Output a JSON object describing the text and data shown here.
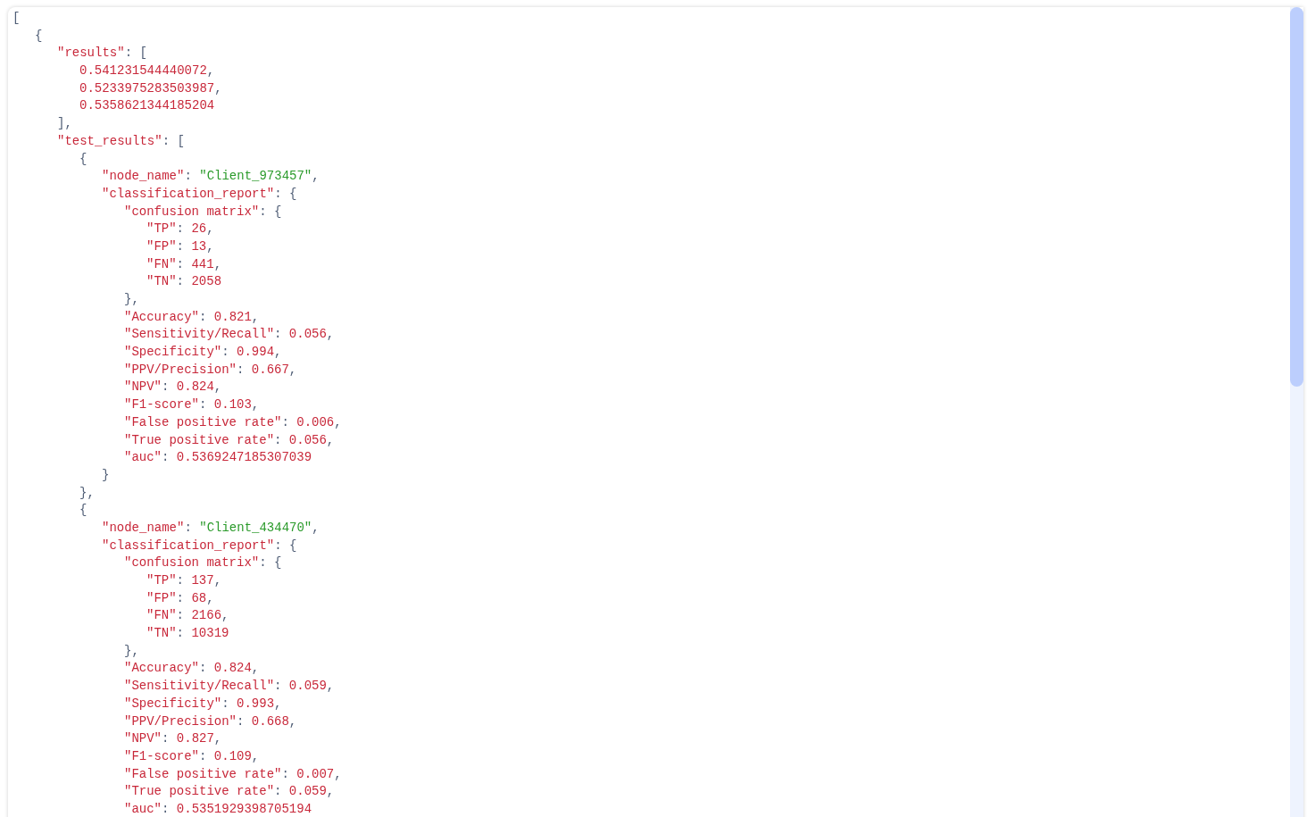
{
  "document": {
    "tokens": [
      {
        "kind": "punct",
        "text": "["
      }
    ],
    "children": [
      {
        "tokens": [
          {
            "kind": "punct",
            "text": "{"
          }
        ],
        "children": [
          {
            "tokens": [
              {
                "kind": "key",
                "text": "\"results\""
              },
              {
                "kind": "punct",
                "text": ": ["
              }
            ],
            "children": [
              {
                "tokens": [
                  {
                    "kind": "number",
                    "text": "0.541231544440072"
                  },
                  {
                    "kind": "punct",
                    "text": ","
                  }
                ]
              },
              {
                "tokens": [
                  {
                    "kind": "number",
                    "text": "0.5233975283503987"
                  },
                  {
                    "kind": "punct",
                    "text": ","
                  }
                ]
              },
              {
                "tokens": [
                  {
                    "kind": "number",
                    "text": "0.5358621344185204"
                  }
                ]
              }
            ],
            "close": [
              {
                "kind": "punct",
                "text": "],"
              }
            ]
          },
          {
            "tokens": [
              {
                "kind": "key",
                "text": "\"test_results\""
              },
              {
                "kind": "punct",
                "text": ": ["
              }
            ],
            "children": [
              {
                "tokens": [
                  {
                    "kind": "punct",
                    "text": "{"
                  }
                ],
                "children": [
                  {
                    "tokens": [
                      {
                        "kind": "key",
                        "text": "\"node_name\""
                      },
                      {
                        "kind": "punct",
                        "text": ": "
                      },
                      {
                        "kind": "string",
                        "text": "\"Client_973457\""
                      },
                      {
                        "kind": "punct",
                        "text": ","
                      }
                    ]
                  },
                  {
                    "tokens": [
                      {
                        "kind": "key",
                        "text": "\"classification_report\""
                      },
                      {
                        "kind": "punct",
                        "text": ": {"
                      }
                    ],
                    "children": [
                      {
                        "tokens": [
                          {
                            "kind": "key",
                            "text": "\"confusion matrix\""
                          },
                          {
                            "kind": "punct",
                            "text": ": {"
                          }
                        ],
                        "children": [
                          {
                            "tokens": [
                              {
                                "kind": "key",
                                "text": "\"TP\""
                              },
                              {
                                "kind": "punct",
                                "text": ": "
                              },
                              {
                                "kind": "number",
                                "text": "26"
                              },
                              {
                                "kind": "punct",
                                "text": ","
                              }
                            ]
                          },
                          {
                            "tokens": [
                              {
                                "kind": "key",
                                "text": "\"FP\""
                              },
                              {
                                "kind": "punct",
                                "text": ": "
                              },
                              {
                                "kind": "number",
                                "text": "13"
                              },
                              {
                                "kind": "punct",
                                "text": ","
                              }
                            ]
                          },
                          {
                            "tokens": [
                              {
                                "kind": "key",
                                "text": "\"FN\""
                              },
                              {
                                "kind": "punct",
                                "text": ": "
                              },
                              {
                                "kind": "number",
                                "text": "441"
                              },
                              {
                                "kind": "punct",
                                "text": ","
                              }
                            ]
                          },
                          {
                            "tokens": [
                              {
                                "kind": "key",
                                "text": "\"TN\""
                              },
                              {
                                "kind": "punct",
                                "text": ": "
                              },
                              {
                                "kind": "number",
                                "text": "2058"
                              }
                            ]
                          }
                        ],
                        "close": [
                          {
                            "kind": "punct",
                            "text": "},"
                          }
                        ]
                      },
                      {
                        "tokens": [
                          {
                            "kind": "key",
                            "text": "\"Accuracy\""
                          },
                          {
                            "kind": "punct",
                            "text": ": "
                          },
                          {
                            "kind": "number",
                            "text": "0.821"
                          },
                          {
                            "kind": "punct",
                            "text": ","
                          }
                        ]
                      },
                      {
                        "tokens": [
                          {
                            "kind": "key",
                            "text": "\"Sensitivity/Recall\""
                          },
                          {
                            "kind": "punct",
                            "text": ": "
                          },
                          {
                            "kind": "number",
                            "text": "0.056"
                          },
                          {
                            "kind": "punct",
                            "text": ","
                          }
                        ]
                      },
                      {
                        "tokens": [
                          {
                            "kind": "key",
                            "text": "\"Specificity\""
                          },
                          {
                            "kind": "punct",
                            "text": ": "
                          },
                          {
                            "kind": "number",
                            "text": "0.994"
                          },
                          {
                            "kind": "punct",
                            "text": ","
                          }
                        ]
                      },
                      {
                        "tokens": [
                          {
                            "kind": "key",
                            "text": "\"PPV/Precision\""
                          },
                          {
                            "kind": "punct",
                            "text": ": "
                          },
                          {
                            "kind": "number",
                            "text": "0.667"
                          },
                          {
                            "kind": "punct",
                            "text": ","
                          }
                        ]
                      },
                      {
                        "tokens": [
                          {
                            "kind": "key",
                            "text": "\"NPV\""
                          },
                          {
                            "kind": "punct",
                            "text": ": "
                          },
                          {
                            "kind": "number",
                            "text": "0.824"
                          },
                          {
                            "kind": "punct",
                            "text": ","
                          }
                        ]
                      },
                      {
                        "tokens": [
                          {
                            "kind": "key",
                            "text": "\"F1-score\""
                          },
                          {
                            "kind": "punct",
                            "text": ": "
                          },
                          {
                            "kind": "number",
                            "text": "0.103"
                          },
                          {
                            "kind": "punct",
                            "text": ","
                          }
                        ]
                      },
                      {
                        "tokens": [
                          {
                            "kind": "key",
                            "text": "\"False positive rate\""
                          },
                          {
                            "kind": "punct",
                            "text": ": "
                          },
                          {
                            "kind": "number",
                            "text": "0.006"
                          },
                          {
                            "kind": "punct",
                            "text": ","
                          }
                        ]
                      },
                      {
                        "tokens": [
                          {
                            "kind": "key",
                            "text": "\"True positive rate\""
                          },
                          {
                            "kind": "punct",
                            "text": ": "
                          },
                          {
                            "kind": "number",
                            "text": "0.056"
                          },
                          {
                            "kind": "punct",
                            "text": ","
                          }
                        ]
                      },
                      {
                        "tokens": [
                          {
                            "kind": "key",
                            "text": "\"auc\""
                          },
                          {
                            "kind": "punct",
                            "text": ": "
                          },
                          {
                            "kind": "number",
                            "text": "0.5369247185307039"
                          }
                        ]
                      }
                    ],
                    "close": [
                      {
                        "kind": "punct",
                        "text": "}"
                      }
                    ]
                  }
                ],
                "close": [
                  {
                    "kind": "punct",
                    "text": "},"
                  }
                ]
              },
              {
                "tokens": [
                  {
                    "kind": "punct",
                    "text": "{"
                  }
                ],
                "children": [
                  {
                    "tokens": [
                      {
                        "kind": "key",
                        "text": "\"node_name\""
                      },
                      {
                        "kind": "punct",
                        "text": ": "
                      },
                      {
                        "kind": "string",
                        "text": "\"Client_434470\""
                      },
                      {
                        "kind": "punct",
                        "text": ","
                      }
                    ]
                  },
                  {
                    "tokens": [
                      {
                        "kind": "key",
                        "text": "\"classification_report\""
                      },
                      {
                        "kind": "punct",
                        "text": ": {"
                      }
                    ],
                    "children": [
                      {
                        "tokens": [
                          {
                            "kind": "key",
                            "text": "\"confusion matrix\""
                          },
                          {
                            "kind": "punct",
                            "text": ": {"
                          }
                        ],
                        "children": [
                          {
                            "tokens": [
                              {
                                "kind": "key",
                                "text": "\"TP\""
                              },
                              {
                                "kind": "punct",
                                "text": ": "
                              },
                              {
                                "kind": "number",
                                "text": "137"
                              },
                              {
                                "kind": "punct",
                                "text": ","
                              }
                            ]
                          },
                          {
                            "tokens": [
                              {
                                "kind": "key",
                                "text": "\"FP\""
                              },
                              {
                                "kind": "punct",
                                "text": ": "
                              },
                              {
                                "kind": "number",
                                "text": "68"
                              },
                              {
                                "kind": "punct",
                                "text": ","
                              }
                            ]
                          },
                          {
                            "tokens": [
                              {
                                "kind": "key",
                                "text": "\"FN\""
                              },
                              {
                                "kind": "punct",
                                "text": ": "
                              },
                              {
                                "kind": "number",
                                "text": "2166"
                              },
                              {
                                "kind": "punct",
                                "text": ","
                              }
                            ]
                          },
                          {
                            "tokens": [
                              {
                                "kind": "key",
                                "text": "\"TN\""
                              },
                              {
                                "kind": "punct",
                                "text": ": "
                              },
                              {
                                "kind": "number",
                                "text": "10319"
                              }
                            ]
                          }
                        ],
                        "close": [
                          {
                            "kind": "punct",
                            "text": "},"
                          }
                        ]
                      },
                      {
                        "tokens": [
                          {
                            "kind": "key",
                            "text": "\"Accuracy\""
                          },
                          {
                            "kind": "punct",
                            "text": ": "
                          },
                          {
                            "kind": "number",
                            "text": "0.824"
                          },
                          {
                            "kind": "punct",
                            "text": ","
                          }
                        ]
                      },
                      {
                        "tokens": [
                          {
                            "kind": "key",
                            "text": "\"Sensitivity/Recall\""
                          },
                          {
                            "kind": "punct",
                            "text": ": "
                          },
                          {
                            "kind": "number",
                            "text": "0.059"
                          },
                          {
                            "kind": "punct",
                            "text": ","
                          }
                        ]
                      },
                      {
                        "tokens": [
                          {
                            "kind": "key",
                            "text": "\"Specificity\""
                          },
                          {
                            "kind": "punct",
                            "text": ": "
                          },
                          {
                            "kind": "number",
                            "text": "0.993"
                          },
                          {
                            "kind": "punct",
                            "text": ","
                          }
                        ]
                      },
                      {
                        "tokens": [
                          {
                            "kind": "key",
                            "text": "\"PPV/Precision\""
                          },
                          {
                            "kind": "punct",
                            "text": ": "
                          },
                          {
                            "kind": "number",
                            "text": "0.668"
                          },
                          {
                            "kind": "punct",
                            "text": ","
                          }
                        ]
                      },
                      {
                        "tokens": [
                          {
                            "kind": "key",
                            "text": "\"NPV\""
                          },
                          {
                            "kind": "punct",
                            "text": ": "
                          },
                          {
                            "kind": "number",
                            "text": "0.827"
                          },
                          {
                            "kind": "punct",
                            "text": ","
                          }
                        ]
                      },
                      {
                        "tokens": [
                          {
                            "kind": "key",
                            "text": "\"F1-score\""
                          },
                          {
                            "kind": "punct",
                            "text": ": "
                          },
                          {
                            "kind": "number",
                            "text": "0.109"
                          },
                          {
                            "kind": "punct",
                            "text": ","
                          }
                        ]
                      },
                      {
                        "tokens": [
                          {
                            "kind": "key",
                            "text": "\"False positive rate\""
                          },
                          {
                            "kind": "punct",
                            "text": ": "
                          },
                          {
                            "kind": "number",
                            "text": "0.007"
                          },
                          {
                            "kind": "punct",
                            "text": ","
                          }
                        ]
                      },
                      {
                        "tokens": [
                          {
                            "kind": "key",
                            "text": "\"True positive rate\""
                          },
                          {
                            "kind": "punct",
                            "text": ": "
                          },
                          {
                            "kind": "number",
                            "text": "0.059"
                          },
                          {
                            "kind": "punct",
                            "text": ","
                          }
                        ]
                      },
                      {
                        "tokens": [
                          {
                            "kind": "key",
                            "text": "\"auc\""
                          },
                          {
                            "kind": "punct",
                            "text": ": "
                          },
                          {
                            "kind": "number",
                            "text": "0.5351929398705194"
                          }
                        ]
                      }
                    ]
                  }
                ]
              }
            ]
          }
        ]
      }
    ]
  }
}
